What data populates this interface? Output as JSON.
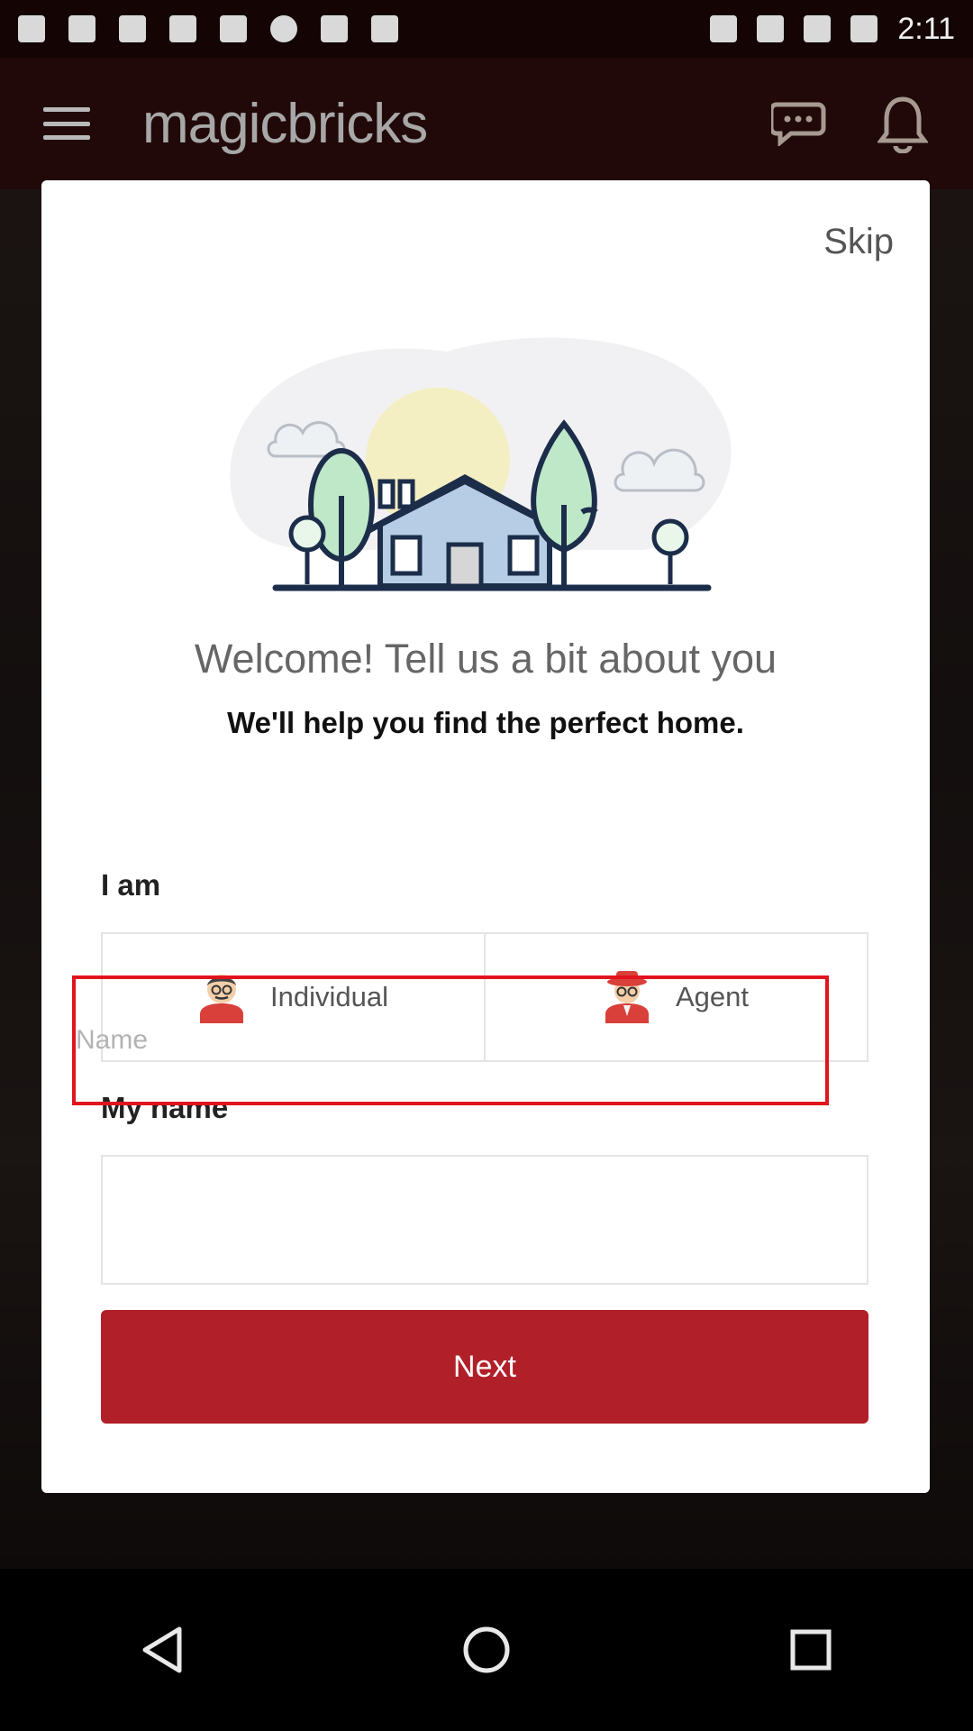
{
  "status_bar": {
    "time": "2:11"
  },
  "app": {
    "brand": "magicbricks"
  },
  "modal": {
    "skip_label": "Skip",
    "welcome_title": "Welcome! Tell us a bit about you",
    "subtitle": "We'll help you find the perfect home.",
    "i_am_label": "I am",
    "options": [
      {
        "label": "Individual",
        "icon": "individual-avatar-icon"
      },
      {
        "label": "Agent",
        "icon": "agent-avatar-icon"
      }
    ],
    "my_name_label": "My name",
    "name_input": {
      "placeholder": "Name",
      "value": ""
    },
    "next_label": "Next"
  },
  "colors": {
    "accent": "#b11f29",
    "focus_border": "#e1141e",
    "topbar": "#4a1216"
  }
}
